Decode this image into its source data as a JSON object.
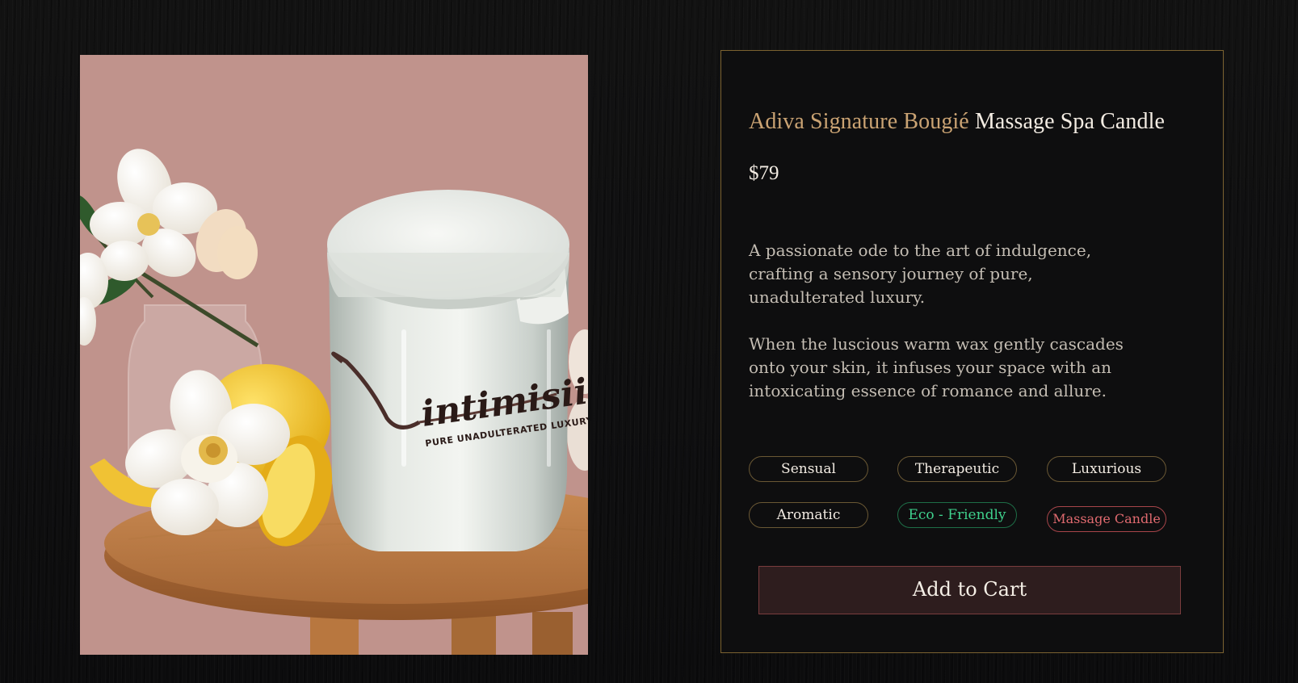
{
  "product": {
    "title_brand": "Adiva Signature Bougié",
    "title_name": "Massage Spa Candle",
    "price": "$79",
    "description": [
      "A passionate ode to the art of indulgence, crafting a sensory journey of pure, unadulterated luxury.",
      "When the luscious warm wax gently cascades onto your skin, it infuses your space with an intoxicating essence of romance and allure."
    ],
    "tags": [
      {
        "label": "Sensual",
        "style": "default"
      },
      {
        "label": "Therapeutic",
        "style": "default"
      },
      {
        "label": "Luxurious",
        "style": "default"
      },
      {
        "label": "Aromatic",
        "style": "default"
      },
      {
        "label": "Eco - Friendly",
        "style": "green"
      },
      {
        "label": "Massage Candle",
        "style": "red"
      }
    ],
    "add_to_cart_label": "Add to Cart"
  },
  "image": {
    "jar_logo_text": "intimisii",
    "jar_tagline_text": "PURE UNADULTERATED LUXURY"
  },
  "colors": {
    "accent_gold": "#caa373",
    "card_border": "#7b6230",
    "eco_green": "#3fd18d",
    "massage_red": "#e06a6f",
    "button_bg": "#2e1d1e"
  }
}
